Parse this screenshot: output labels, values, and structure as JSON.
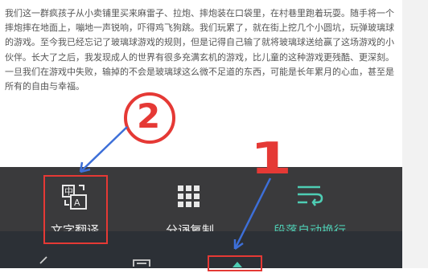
{
  "document": {
    "paragraph": "我们这一群疯孩子从小卖铺里买来麻雷子、拉炮、摔炮装在口袋里，在村巷里跑着玩耍。随手将一个摔炮摔在地面上，嘣地一声锐响，吓得鸡飞狗跳。我们玩累了，就在街上挖几个小圆坑，玩弹玻璃球的游戏。至今我已经忘记了玻璃球游戏的规则，但是记得自己输了就将玻璃球送给赢了这场游戏的小伙伴。长大了之后，我发现成人的世界有很多充满玄机的游戏，比儿童的这种游戏更残酷、更深刻。一旦我们在游戏中失败，输掉的不会是玻璃球这么微不足道的东西，可能是长年累月的心血，甚至是所有的自由与幸福。"
  },
  "toolbar": {
    "translate_label": "文字翻译",
    "segment_copy_label": "分词复制",
    "auto_wrap_label": "段落自动换行"
  },
  "annotations": {
    "circle_2": "2",
    "mark_1": "1"
  },
  "colors": {
    "panel_bg": "#3a3a3c",
    "nav_bg": "#2c3036",
    "accent_teal": "#4ecdb4",
    "highlight_red": "#e53935",
    "arrow_blue": "#3d6fd8"
  },
  "icons": {
    "translate": "translate-icon",
    "grid": "grid-icon",
    "wrap": "wrap-lines-icon",
    "back": "back-icon",
    "crop": "crop-icon",
    "up": "up-arrow-icon"
  }
}
